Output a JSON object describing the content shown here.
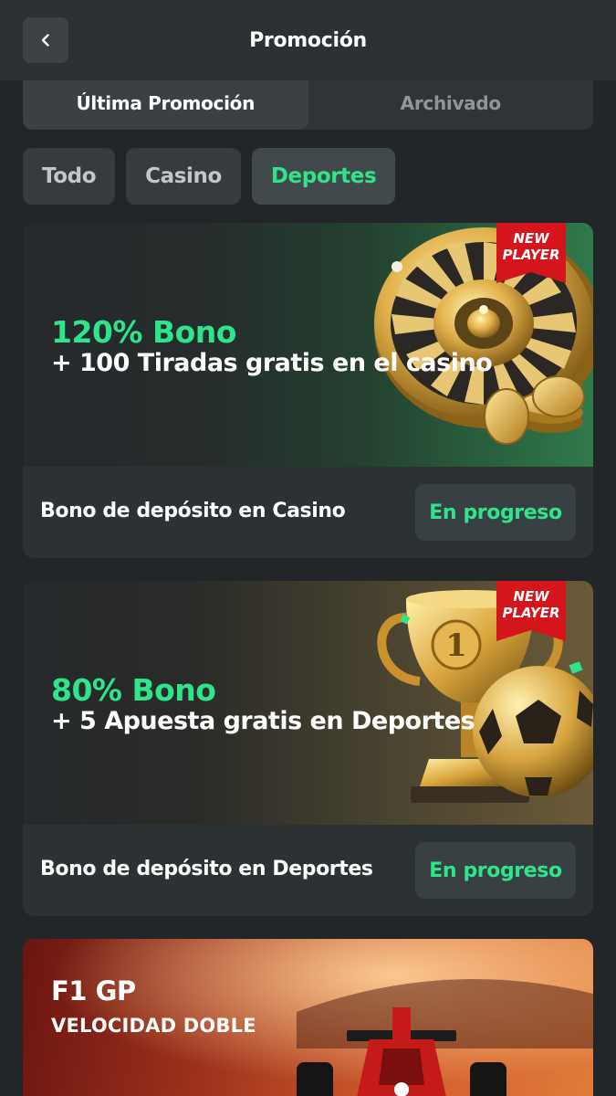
{
  "header": {
    "title": "Promoción",
    "back_icon": "chevron-left-icon"
  },
  "tabs": [
    {
      "label": "Última Promoción",
      "active": true
    },
    {
      "label": "Archivado",
      "active": false
    }
  ],
  "filters": [
    {
      "label": "Todo",
      "active": false
    },
    {
      "label": "Casino",
      "active": false
    },
    {
      "label": "Deportes",
      "active": true
    }
  ],
  "promotions": [
    {
      "bonus": "120% Bono",
      "subtitle": "+ 100 Tiradas gratis en el casino",
      "badge": "NEW PLAYER",
      "badge_line1": "NEW",
      "badge_line2": "PLAYER",
      "label": "Bono de depósito en Casino",
      "status": "En progreso",
      "art": "roulette-icon"
    },
    {
      "bonus": "80% Bono",
      "subtitle": "+ 5 Apuesta gratis en Deportes",
      "badge": "NEW PLAYER",
      "badge_line1": "NEW",
      "badge_line2": "PLAYER",
      "label": "Bono de depósito en Deportes",
      "status": "En progreso",
      "art": "trophy-icon"
    },
    {
      "title": "F1 GP",
      "subtitle": "VELOCIDAD DOBLE",
      "art": "race-car-icon"
    }
  ],
  "colors": {
    "accent": "#2ee58c",
    "background": "#232628",
    "card": "#2c3133",
    "badge": "#d4161c"
  }
}
